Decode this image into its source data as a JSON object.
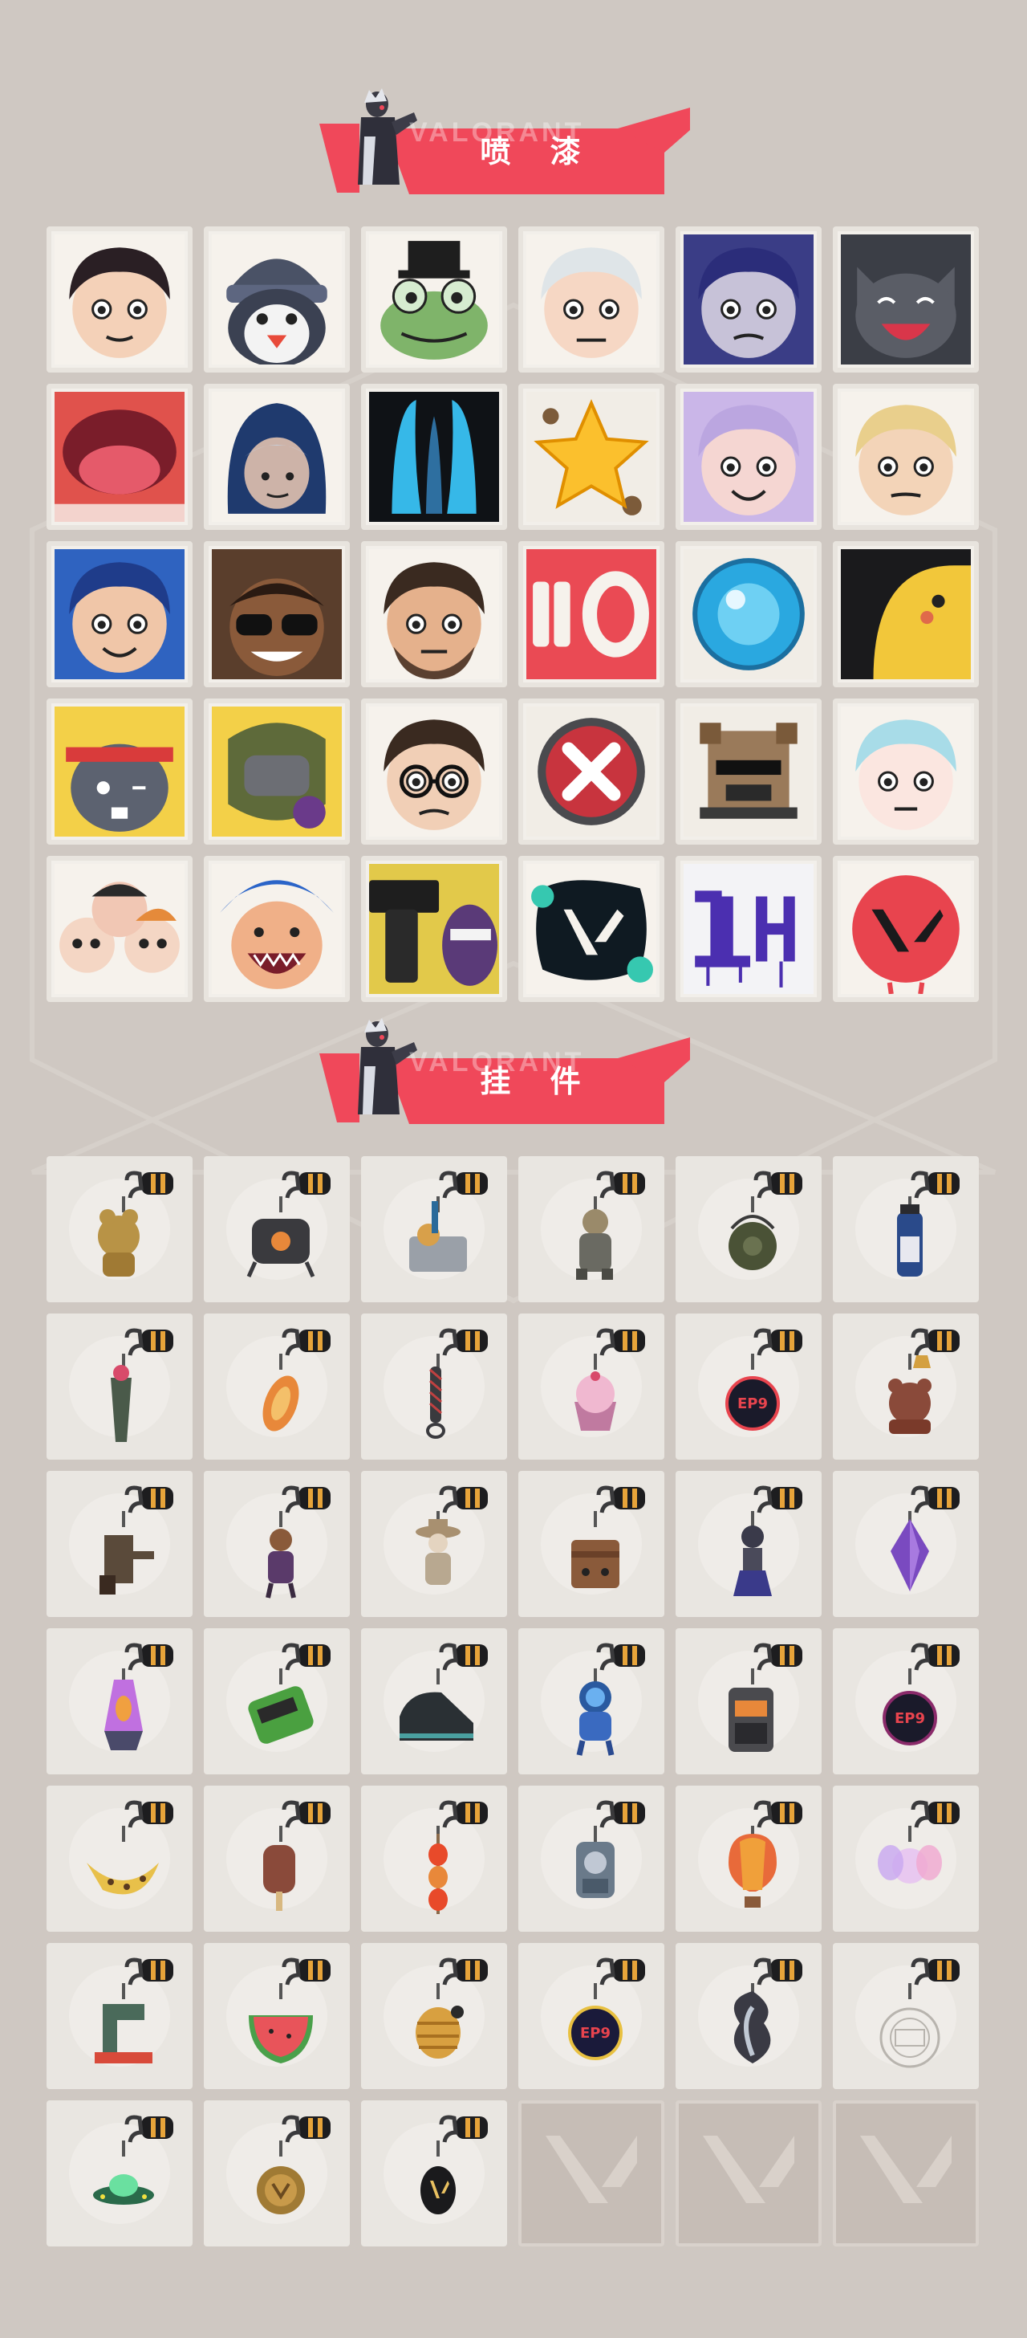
{
  "sections": {
    "sprays": {
      "title": "喷 漆",
      "watermark": "VALORANT"
    },
    "charms": {
      "title": "挂 件",
      "watermark": "VALORANT"
    }
  },
  "colors": {
    "background": "#cfc8c2",
    "banner_red": "#f0485a",
    "banner_dark": "#c83848",
    "tile_bg": "#ebe8e3",
    "empty_tile": "#c6bdb6"
  },
  "sprays": [
    {
      "icon": "girl-face-spray"
    },
    {
      "icon": "penguin-beanie-spray"
    },
    {
      "icon": "frog-tophat-spray"
    },
    {
      "icon": "boy-face-spray"
    },
    {
      "icon": "blue-hair-agent-spray"
    },
    {
      "icon": "laughing-cat-spray"
    },
    {
      "icon": "open-mouth-spray"
    },
    {
      "icon": "hooded-agent-spray"
    },
    {
      "icon": "blue-stripes-spray"
    },
    {
      "icon": "star-spray"
    },
    {
      "icon": "winking-girl-spray"
    },
    {
      "icon": "blonde-agent-spray"
    },
    {
      "icon": "smirking-girl-spray"
    },
    {
      "icon": "sunglasses-agent-spray"
    },
    {
      "icon": "bearded-agent-spray"
    },
    {
      "icon": "ammo-counter-spray"
    },
    {
      "icon": "blue-orb-spray"
    },
    {
      "icon": "yellow-bird-spray"
    },
    {
      "icon": "headband-creature-spray"
    },
    {
      "icon": "fist-spray"
    },
    {
      "icon": "glasses-agent-spray"
    },
    {
      "icon": "red-x-button-spray"
    },
    {
      "icon": "pixel-dog-spray"
    },
    {
      "icon": "angry-girl-spray"
    },
    {
      "icon": "crowd-faces-spray"
    },
    {
      "icon": "screaming-agent-spray"
    },
    {
      "icon": "gun-spray"
    },
    {
      "icon": "valorant-logo-splatter-spray"
    },
    {
      "icon": "graffiti-tag-spray"
    },
    {
      "icon": "red-valorant-logo-spray"
    }
  ],
  "charms": [
    {
      "icon": "gold-bear-charm"
    },
    {
      "icon": "robot-drone-charm"
    },
    {
      "icon": "cart-charm"
    },
    {
      "icon": "armored-figure-charm"
    },
    {
      "icon": "grenade-charm"
    },
    {
      "icon": "vial-charm"
    },
    {
      "icon": "chainsaw-sword-charm"
    },
    {
      "icon": "fish-snack-charm"
    },
    {
      "icon": "paracord-charm"
    },
    {
      "icon": "cupcake-charm"
    },
    {
      "icon": "ep9-medal-charm"
    },
    {
      "icon": "bear-bell-charm"
    },
    {
      "icon": "tool-charm"
    },
    {
      "icon": "agent-figure-charm"
    },
    {
      "icon": "cowboy-figure-charm"
    },
    {
      "icon": "box-charm"
    },
    {
      "icon": "tassel-figure-charm"
    },
    {
      "icon": "purple-crystal-charm"
    },
    {
      "icon": "lava-lamp-charm"
    },
    {
      "icon": "green-pager-charm"
    },
    {
      "icon": "sneaker-charm"
    },
    {
      "icon": "astronaut-charm"
    },
    {
      "icon": "radio-charm"
    },
    {
      "icon": "ep9-medal-dark-charm"
    },
    {
      "icon": "banana-charm"
    },
    {
      "icon": "popsicle-charm"
    },
    {
      "icon": "chili-skewer-charm"
    },
    {
      "icon": "agent-keychain-charm"
    },
    {
      "icon": "hot-air-balloon-charm"
    },
    {
      "icon": "fairy-charm"
    },
    {
      "icon": "sewing-machine-charm"
    },
    {
      "icon": "watermelon-charm"
    },
    {
      "icon": "bee-hive-charm"
    },
    {
      "icon": "ep9-medal-blue-charm"
    },
    {
      "icon": "swan-charm"
    },
    {
      "icon": "ep10-badge-charm"
    },
    {
      "icon": "ufo-charm"
    },
    {
      "icon": "gold-coin-charm"
    },
    {
      "icon": "valorant-tag-charm"
    },
    {
      "icon": "empty-slot"
    },
    {
      "icon": "empty-slot"
    },
    {
      "icon": "empty-slot"
    }
  ]
}
